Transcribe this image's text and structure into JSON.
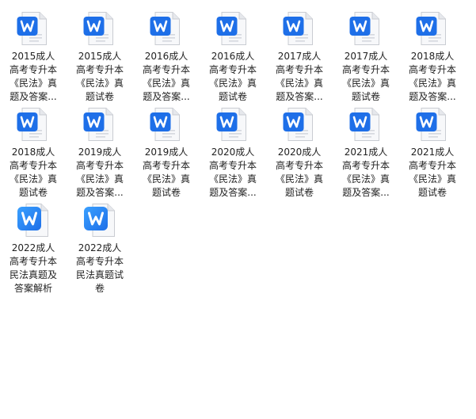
{
  "files": [
    {
      "name": "2015成人\n高考专升本\n《民法》真\n题及答案...",
      "icon": "wps-word-doc-icon",
      "style": "outline"
    },
    {
      "name": "2015成人\n高考专升本\n《民法》真\n题试卷",
      "icon": "wps-word-doc-icon",
      "style": "outline"
    },
    {
      "name": "2016成人\n高考专升本\n《民法》真\n题及答案...",
      "icon": "wps-word-doc-icon",
      "style": "outline"
    },
    {
      "name": "2016成人\n高考专升本\n《民法》真\n题试卷",
      "icon": "wps-word-doc-icon",
      "style": "outline"
    },
    {
      "name": "2017成人\n高考专升本\n《民法》真\n题及答案...",
      "icon": "wps-word-doc-icon",
      "style": "outline"
    },
    {
      "name": "2017成人\n高考专升本\n《民法》真\n题试卷",
      "icon": "wps-word-doc-icon",
      "style": "outline"
    },
    {
      "name": "2018成人\n高考专升本\n《民法》真\n题及答案...",
      "icon": "wps-word-doc-icon",
      "style": "outline"
    },
    {
      "name": "2018成人\n高考专升本\n《民法》真\n题试卷",
      "icon": "wps-word-doc-icon",
      "style": "outline"
    },
    {
      "name": "2019成人\n高考专升本\n《民法》真\n题及答案...",
      "icon": "wps-word-doc-icon",
      "style": "outline"
    },
    {
      "name": "2019成人\n高考专升本\n《民法》真\n题试卷",
      "icon": "wps-word-doc-icon",
      "style": "outline"
    },
    {
      "name": "2020成人\n高考专升本\n《民法》真\n题及答案...",
      "icon": "wps-word-doc-icon",
      "style": "outline"
    },
    {
      "name": "2020成人\n高考专升本\n《民法》真\n题试卷",
      "icon": "wps-word-doc-icon",
      "style": "outline"
    },
    {
      "name": "2021成人\n高考专升本\n《民法》真\n题及答案...",
      "icon": "wps-word-doc-icon",
      "style": "outline"
    },
    {
      "name": "2021成人\n高考专升本\n《民法》真\n题试卷",
      "icon": "wps-word-doc-icon",
      "style": "outline"
    },
    {
      "name": "2022成人\n高考专升本\n民法真题及\n答案解析",
      "icon": "wps-word-doc-icon",
      "style": "filled"
    },
    {
      "name": "2022成人\n高考专升本\n民法真题试\n卷",
      "icon": "wps-word-doc-icon",
      "style": "filled"
    }
  ],
  "colors": {
    "accent": "#1e6fe8",
    "accent_light": "#3aa0ff",
    "page": "#f7f8fa",
    "page_edge": "#c9ccd2",
    "text": "#222222"
  }
}
